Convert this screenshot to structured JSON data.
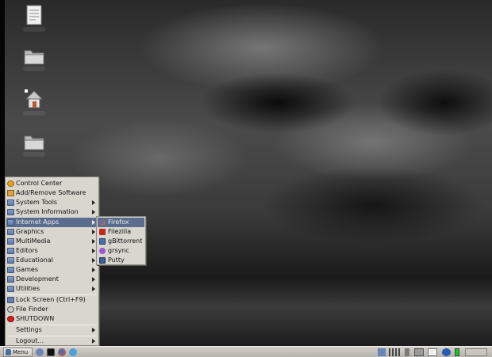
{
  "desktop": {
    "icons": [
      {
        "name": "document",
        "caption": ""
      },
      {
        "name": "folder",
        "caption": ""
      },
      {
        "name": "home",
        "caption": ""
      },
      {
        "name": "folder",
        "caption": ""
      }
    ]
  },
  "start_menu": {
    "items": [
      {
        "label": "Control Center",
        "icon": "control-center-icon",
        "submenu": false
      },
      {
        "label": "Add/Remove Software",
        "icon": "package-icon",
        "submenu": false
      },
      {
        "label": "System Tools",
        "icon": "folder-icon",
        "submenu": true
      },
      {
        "label": "System Information",
        "icon": "folder-icon",
        "submenu": true
      },
      {
        "label": "Internet Apps",
        "icon": "folder-icon",
        "submenu": true,
        "highlighted": true
      },
      {
        "label": "Graphics",
        "icon": "folder-icon",
        "submenu": true
      },
      {
        "label": "MultiMedia",
        "icon": "folder-icon",
        "submenu": true
      },
      {
        "label": "Editors",
        "icon": "folder-icon",
        "submenu": true
      },
      {
        "label": "Educational",
        "icon": "folder-icon",
        "submenu": true
      },
      {
        "label": "Games",
        "icon": "folder-icon",
        "submenu": true
      },
      {
        "label": "Development",
        "icon": "folder-icon",
        "submenu": true
      },
      {
        "label": "Utilities",
        "icon": "folder-icon",
        "submenu": true
      },
      {
        "label": "Lock Screen (Ctrl+F9)",
        "icon": "lock-icon",
        "submenu": false
      },
      {
        "label": "File Finder",
        "icon": "search-icon",
        "submenu": false
      },
      {
        "label": "SHUTDOWN",
        "icon": "shutdown-icon",
        "submenu": false
      },
      {
        "label": "Settings",
        "icon": "",
        "submenu": true
      },
      {
        "label": "Logout...",
        "icon": "",
        "submenu": true
      }
    ]
  },
  "internet_submenu": {
    "items": [
      {
        "label": "Firefox",
        "icon": "firefox-icon",
        "highlighted": true
      },
      {
        "label": "Filezilla",
        "icon": "filezilla-icon"
      },
      {
        "label": "gBittorrent",
        "icon": "bittorrent-icon"
      },
      {
        "label": "grsync",
        "icon": "grsync-icon"
      },
      {
        "label": "Putty",
        "icon": "putty-icon"
      }
    ]
  },
  "taskbar": {
    "menu_label": "Menu",
    "launchers": [
      "browser-icon",
      "terminal-icon",
      "firefox-icon",
      "network-icon"
    ],
    "tray": [
      "network-status-icon",
      "volume-mixer-icon",
      "volume-icon",
      "monitor-icon",
      "mail-icon",
      "hp-icon",
      "battery-icon",
      "clock-icon"
    ]
  },
  "colors": {
    "menu_background": "#d9d6cf",
    "highlight": "#5a6d8f",
    "battery": "#18c918"
  }
}
